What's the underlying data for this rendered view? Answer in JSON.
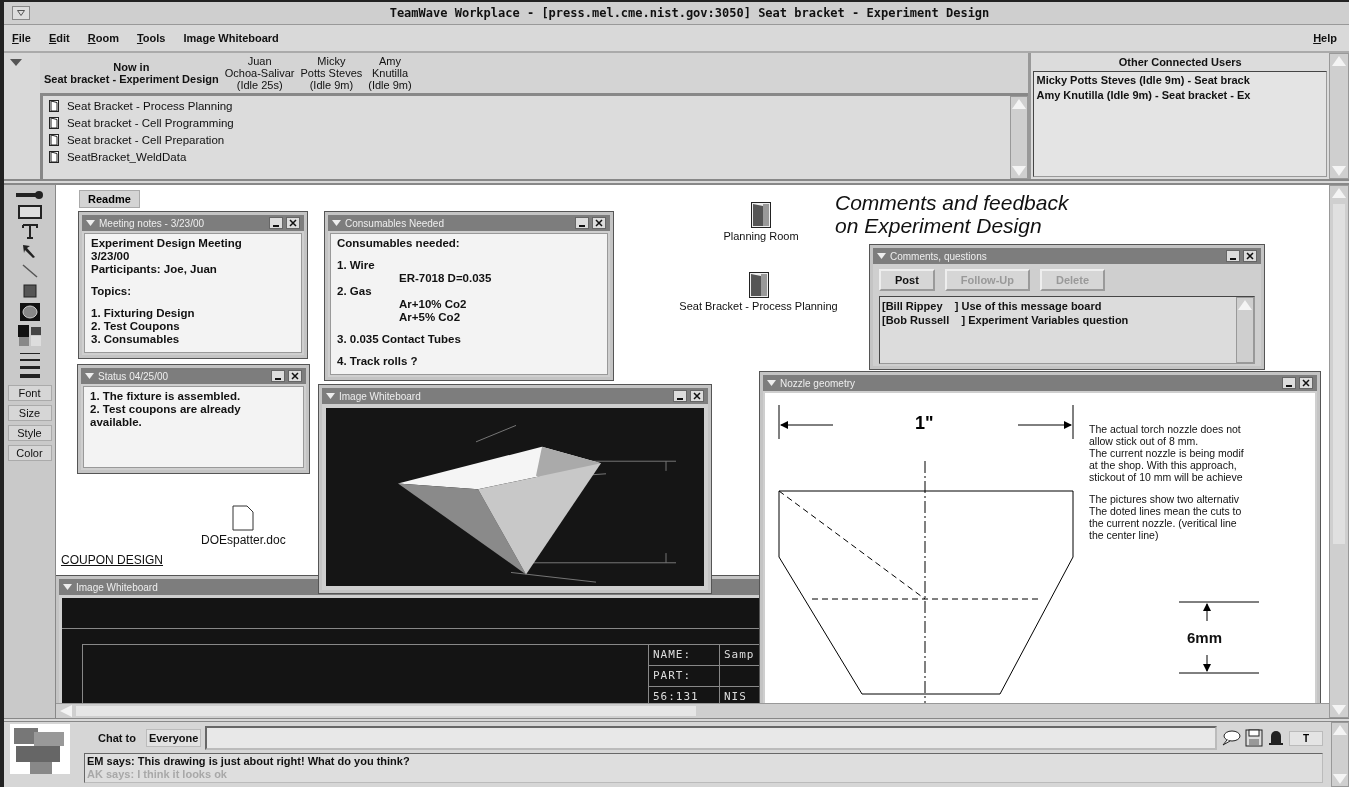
{
  "window": {
    "title": "TeamWave Workplace - [press.mel.cme.nist.gov:3050] Seat bracket - Experiment Design"
  },
  "menu": [
    {
      "label": "File",
      "mnemonic": true
    },
    {
      "label": "Edit",
      "mnemonic": true
    },
    {
      "label": "Room",
      "mnemonic": true
    },
    {
      "label": "Tools",
      "mnemonic": true
    },
    {
      "label": "Image Whiteboard",
      "mnemonic": false
    }
  ],
  "help_menu": {
    "label": "Help",
    "mnemonic": true
  },
  "presence": {
    "heading": "Now in",
    "room": "Seat bracket - Experiment Design",
    "users": [
      {
        "name": [
          "Juan",
          "Ochoa-Salivar"
        ],
        "idle": "(Idle 25s)"
      },
      {
        "name": [
          "Micky",
          "Potts Steves"
        ],
        "idle": "(Idle 9m)"
      },
      {
        "name": [
          "Amy",
          "Knutilla"
        ],
        "idle": "(Idle 9m)"
      }
    ]
  },
  "rooms": [
    "Seat Bracket - Process Planning",
    "Seat bracket - Cell Programming",
    "Seat bracket - Cell Preparation",
    "SeatBracket_WeldData"
  ],
  "other_users": {
    "title": "Other Connected Users",
    "entries": [
      "Micky Potts Steves (Idle 9m) - Seat brack",
      "Amy Knutilla (Idle 9m) - Seat bracket - Ex"
    ]
  },
  "tool_buttons": [
    "Font",
    "Size",
    "Style",
    "Color"
  ],
  "canvas": {
    "readme": "Readme",
    "notes": [
      {
        "title": "Meeting notes - 3/23/00",
        "paragraphs": [
          [
            "Experiment Design Meeting",
            "3/23/00",
            "Participants: Joe, Juan"
          ],
          [
            "Topics:"
          ],
          [
            "1. Fixturing Design",
            "2. Test Coupons",
            "3. Consumables"
          ]
        ]
      },
      {
        "title": "Status 04/25/00",
        "paragraphs": [
          [
            "1. The fixture is assembled.",
            "2. Test coupons are already",
            "available."
          ]
        ]
      },
      {
        "title": "Consumables Needed",
        "paragraphs": [
          [
            {
              "text": "Consumables needed:",
              "indent": false
            }
          ],
          [
            {
              "text": "1. Wire",
              "indent": false
            },
            {
              "text": "ER-7018 D=0.035",
              "indent": true
            },
            {
              "text": "2. Gas",
              "indent": false
            },
            {
              "text": "Ar+10% Co2",
              "indent": true
            },
            {
              "text": "Ar+5% Co2",
              "indent": true
            }
          ],
          [
            {
              "text": "3. 0.035 Contact Tubes",
              "indent": false
            }
          ],
          [
            {
              "text": "4. Track rolls ?",
              "indent": false
            }
          ]
        ]
      }
    ],
    "whiteboards": [
      {
        "title": "Image Whiteboard"
      },
      {
        "title": "Image Whiteboard",
        "title_block": [
          [
            "NAME:",
            "Samp"
          ],
          [
            "PART:"
          ],
          [
            "56:131",
            "NIS"
          ]
        ]
      }
    ],
    "doors": [
      "Planning Room",
      "Seat Bracket - Process Planning"
    ],
    "document": "DOEspatter.doc",
    "link": "COUPON DESIGN",
    "heading": [
      "Comments and feedback",
      "on Experiment Design"
    ],
    "comments": {
      "title": "Comments, questions",
      "buttons": [
        {
          "label": "Post",
          "disabled": false
        },
        {
          "label": "Follow-Up",
          "disabled": true
        },
        {
          "label": "Delete",
          "disabled": true
        }
      ],
      "messages": [
        "[Bill Rippey    ] Use of this message board",
        "[Bob Russell    ] Experiment Variables question"
      ]
    },
    "nozzle": {
      "title": "Nozzle geometry",
      "width_label": "1\"",
      "height_label": "6mm",
      "notes": [
        [
          "The actual torch nozzle does not",
          "allow stick out of 8 mm.",
          "The current nozzle is being modif",
          "at the shop. With this approach,",
          "stickout of 10 mm will be achieve"
        ],
        [
          "The pictures show two alternativ",
          "The doted lines mean the cuts to",
          "the current nozzle. (veritical line",
          "the center line)"
        ]
      ]
    }
  },
  "chat": {
    "label": "Chat to",
    "recipient": "Everyone",
    "format_button": "T",
    "messages": [
      {
        "text": "EM says: This drawing is just about right! What do you think?",
        "dimmed": false
      },
      {
        "text": "AK says: I think it looks ok",
        "dimmed": true
      }
    ]
  }
}
